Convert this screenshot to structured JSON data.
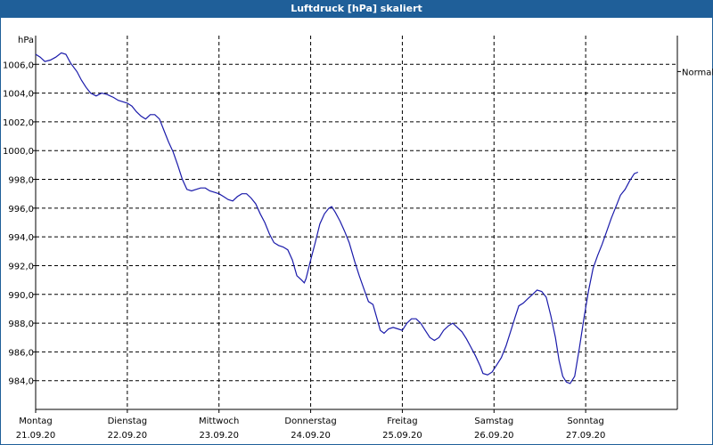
{
  "window": {
    "title": "Luftdruck [hPa] skaliert"
  },
  "chart_data": {
    "type": "line",
    "title": "Luftdruck [hPa] skaliert",
    "ylabel": "hPa",
    "ylim": [
      982.0,
      1008.0
    ],
    "yticks": [
      984.0,
      986.0,
      988.0,
      990.0,
      992.0,
      994.0,
      996.0,
      998.0,
      1000.0,
      1002.0,
      1004.0,
      1006.0
    ],
    "ytick_labels": [
      "984,0",
      "986,0",
      "988,0",
      "990,0",
      "992,0",
      "994,0",
      "996,0",
      "998,0",
      "1000,0",
      "1002,0",
      "1004,0",
      "1006,0"
    ],
    "xlim": [
      0,
      7
    ],
    "xticks": [
      {
        "pos": 0,
        "day": "Montag",
        "date": "21.09.20"
      },
      {
        "pos": 1,
        "day": "Dienstag",
        "date": "22.09.20"
      },
      {
        "pos": 2,
        "day": "Mittwoch",
        "date": "23.09.20"
      },
      {
        "pos": 3,
        "day": "Donnerstag",
        "date": "24.09.20"
      },
      {
        "pos": 4,
        "day": "Freitag",
        "date": "25.09.20"
      },
      {
        "pos": 5,
        "day": "Samstag",
        "date": "26.09.20"
      },
      {
        "pos": 6,
        "day": "Sonntag",
        "date": "27.09.20"
      }
    ],
    "reference_label": "Normal",
    "reference_value": 1005.5,
    "grid": true,
    "series": [
      {
        "color": "#1a1aaa",
        "points": [
          [
            0.0,
            1006.7
          ],
          [
            0.05,
            1006.5
          ],
          [
            0.1,
            1006.2
          ],
          [
            0.16,
            1006.3
          ],
          [
            0.22,
            1006.5
          ],
          [
            0.28,
            1006.8
          ],
          [
            0.33,
            1006.7
          ],
          [
            0.38,
            1006.1
          ],
          [
            0.45,
            1005.5
          ],
          [
            0.5,
            1004.9
          ],
          [
            0.55,
            1004.4
          ],
          [
            0.6,
            1004.0
          ],
          [
            0.66,
            1003.8
          ],
          [
            0.72,
            1004.0
          ],
          [
            0.78,
            1003.9
          ],
          [
            0.85,
            1003.7
          ],
          [
            0.9,
            1003.5
          ],
          [
            0.95,
            1003.4
          ],
          [
            1.0,
            1003.3
          ],
          [
            1.05,
            1003.1
          ],
          [
            1.1,
            1002.7
          ],
          [
            1.15,
            1002.4
          ],
          [
            1.2,
            1002.2
          ],
          [
            1.25,
            1002.5
          ],
          [
            1.3,
            1002.5
          ],
          [
            1.35,
            1002.2
          ],
          [
            1.4,
            1001.4
          ],
          [
            1.45,
            1000.6
          ],
          [
            1.5,
            999.9
          ],
          [
            1.55,
            999.0
          ],
          [
            1.6,
            998.0
          ],
          [
            1.65,
            997.3
          ],
          [
            1.7,
            997.2
          ],
          [
            1.75,
            997.3
          ],
          [
            1.8,
            997.4
          ],
          [
            1.85,
            997.4
          ],
          [
            1.9,
            997.2
          ],
          [
            1.95,
            997.1
          ],
          [
            2.0,
            997.0
          ],
          [
            2.05,
            996.8
          ],
          [
            2.1,
            996.6
          ],
          [
            2.15,
            996.5
          ],
          [
            2.2,
            996.8
          ],
          [
            2.25,
            997.0
          ],
          [
            2.3,
            997.0
          ],
          [
            2.35,
            996.7
          ],
          [
            2.4,
            996.3
          ],
          [
            2.45,
            995.6
          ],
          [
            2.5,
            995.0
          ],
          [
            2.55,
            994.2
          ],
          [
            2.6,
            993.6
          ],
          [
            2.65,
            993.4
          ],
          [
            2.7,
            993.3
          ],
          [
            2.75,
            993.1
          ],
          [
            2.8,
            992.4
          ],
          [
            2.85,
            991.3
          ],
          [
            2.9,
            991.0
          ],
          [
            2.93,
            990.8
          ],
          [
            2.95,
            991.1
          ],
          [
            3.0,
            992.4
          ],
          [
            3.05,
            993.6
          ],
          [
            3.1,
            994.9
          ],
          [
            3.15,
            995.6
          ],
          [
            3.2,
            996.0
          ],
          [
            3.23,
            996.1
          ],
          [
            3.27,
            995.7
          ],
          [
            3.32,
            995.1
          ],
          [
            3.37,
            994.4
          ],
          [
            3.42,
            993.6
          ],
          [
            3.48,
            992.3
          ],
          [
            3.53,
            991.3
          ],
          [
            3.58,
            990.4
          ],
          [
            3.63,
            989.5
          ],
          [
            3.68,
            989.3
          ],
          [
            3.72,
            988.4
          ],
          [
            3.76,
            987.5
          ],
          [
            3.8,
            987.3
          ],
          [
            3.85,
            987.6
          ],
          [
            3.9,
            987.7
          ],
          [
            3.95,
            987.6
          ],
          [
            4.0,
            987.5
          ],
          [
            4.05,
            988.0
          ],
          [
            4.1,
            988.3
          ],
          [
            4.15,
            988.3
          ],
          [
            4.2,
            988.0
          ],
          [
            4.25,
            987.5
          ],
          [
            4.3,
            987.0
          ],
          [
            4.35,
            986.8
          ],
          [
            4.4,
            987.0
          ],
          [
            4.45,
            987.5
          ],
          [
            4.5,
            987.8
          ],
          [
            4.55,
            988.0
          ],
          [
            4.6,
            987.7
          ],
          [
            4.65,
            987.4
          ],
          [
            4.7,
            986.9
          ],
          [
            4.75,
            986.3
          ],
          [
            4.8,
            985.7
          ],
          [
            4.85,
            985.0
          ],
          [
            4.88,
            984.5
          ],
          [
            4.93,
            984.4
          ],
          [
            4.98,
            984.6
          ],
          [
            5.03,
            985.1
          ],
          [
            5.08,
            985.6
          ],
          [
            5.13,
            986.4
          ],
          [
            5.18,
            987.4
          ],
          [
            5.23,
            988.4
          ],
          [
            5.27,
            989.2
          ],
          [
            5.32,
            989.4
          ],
          [
            5.37,
            989.7
          ],
          [
            5.42,
            990.0
          ],
          [
            5.47,
            990.3
          ],
          [
            5.52,
            990.2
          ],
          [
            5.57,
            989.8
          ],
          [
            5.62,
            988.5
          ],
          [
            5.67,
            987.0
          ],
          [
            5.71,
            985.4
          ],
          [
            5.75,
            984.3
          ],
          [
            5.79,
            983.9
          ],
          [
            5.83,
            983.8
          ],
          [
            5.88,
            984.3
          ],
          [
            5.93,
            986.2
          ],
          [
            5.98,
            988.3
          ],
          [
            6.03,
            990.2
          ],
          [
            6.08,
            991.8
          ],
          [
            6.13,
            992.7
          ],
          [
            6.18,
            993.5
          ],
          [
            6.23,
            994.4
          ],
          [
            6.28,
            995.3
          ],
          [
            6.33,
            996.1
          ],
          [
            6.38,
            996.9
          ],
          [
            6.43,
            997.3
          ],
          [
            6.48,
            997.9
          ],
          [
            6.53,
            998.4
          ],
          [
            6.57,
            998.5
          ]
        ]
      }
    ]
  }
}
